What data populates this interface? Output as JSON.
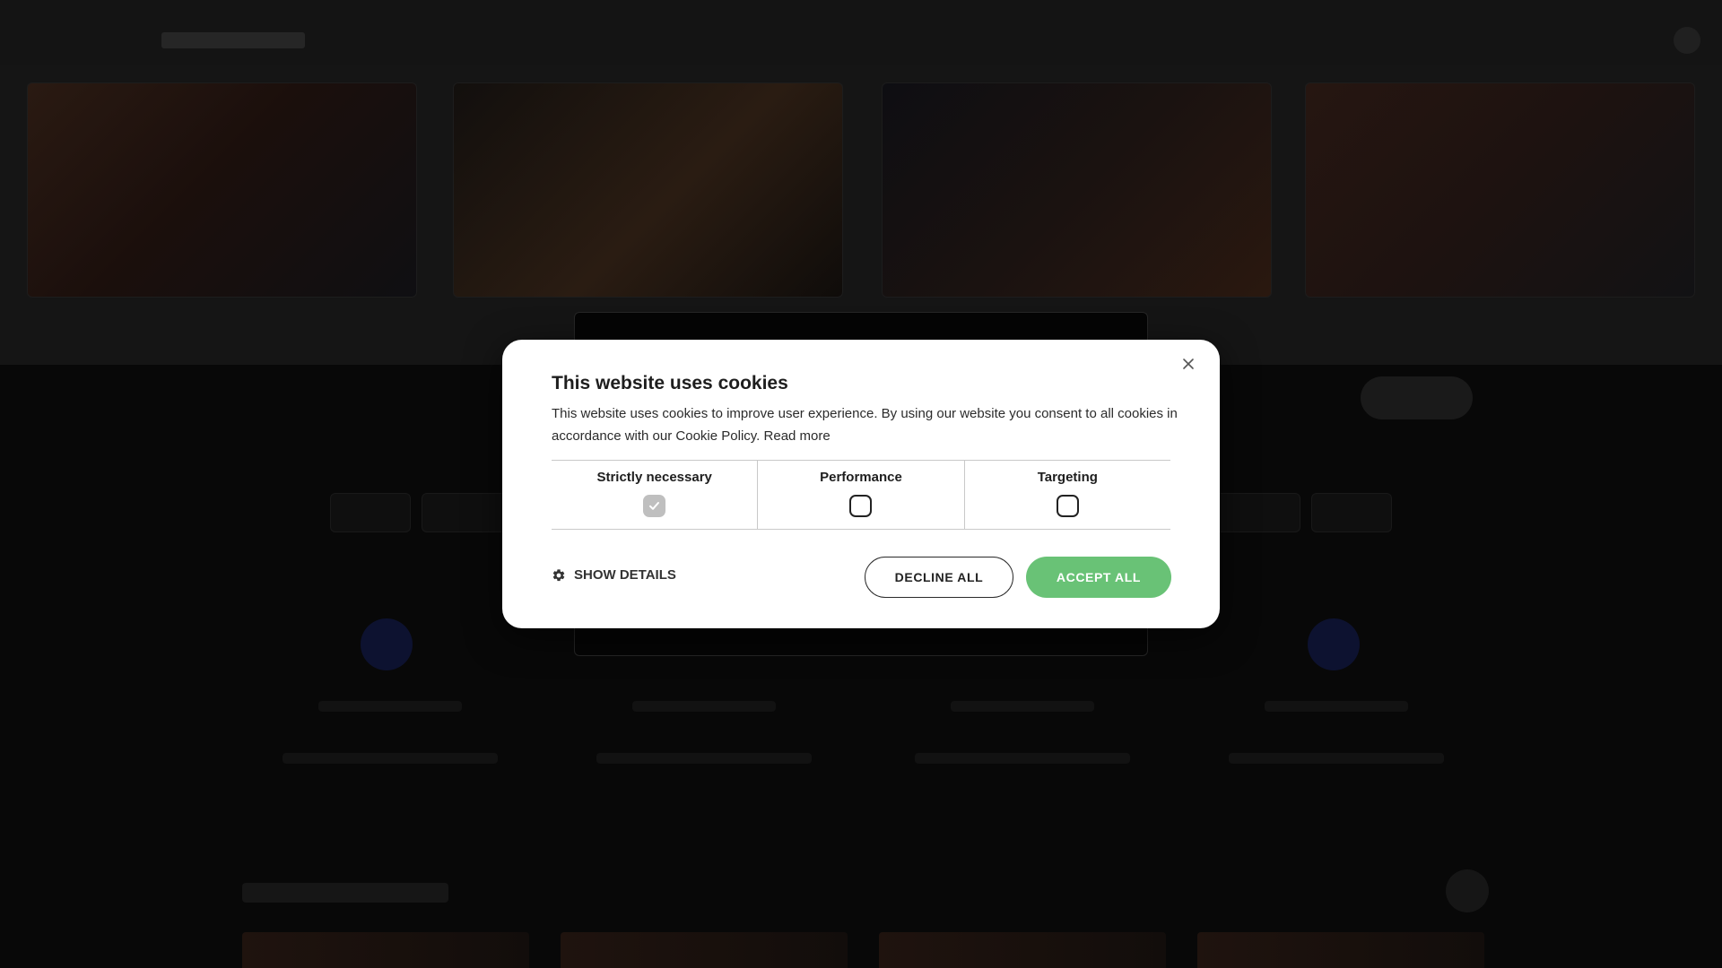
{
  "cookie_dialog": {
    "title": "This website uses cookies",
    "body": "This website uses cookies to improve user experience. By using our website you consent to all cookies in accordance with our Cookie Policy.",
    "read_more": "Read more",
    "categories": [
      {
        "label": "Strictly necessary",
        "checked": true,
        "disabled": true
      },
      {
        "label": "Performance",
        "checked": false,
        "disabled": false
      },
      {
        "label": "Targeting",
        "checked": false,
        "disabled": false
      }
    ],
    "show_details": "SHOW DETAILS",
    "decline_all": "DECLINE ALL",
    "accept_all": "ACCEPT ALL",
    "icons": {
      "close": "close-icon",
      "details": "gear-icon",
      "check": "check-icon"
    },
    "colors": {
      "accept": "#69c276",
      "overlay": "#080808"
    }
  }
}
